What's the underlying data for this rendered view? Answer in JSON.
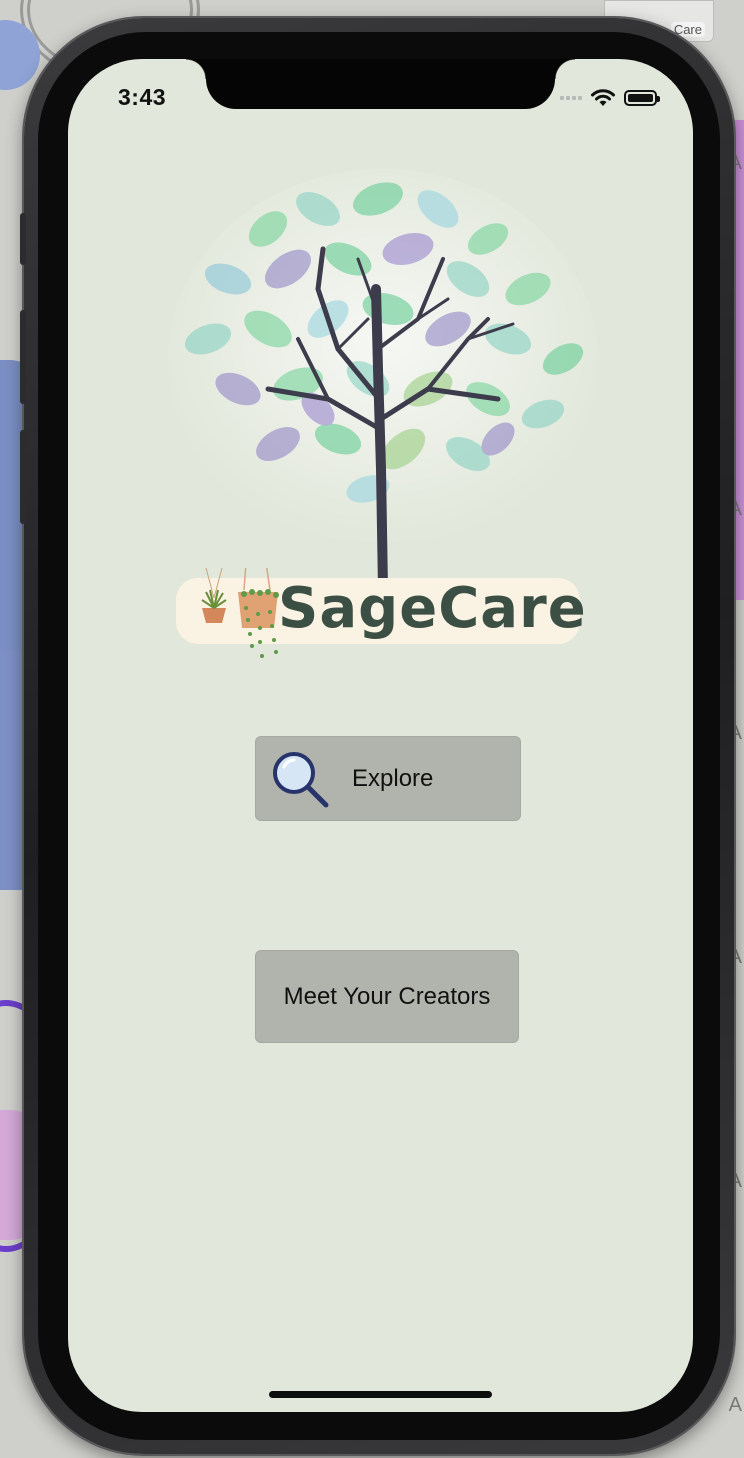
{
  "status_bar": {
    "time": "3:43"
  },
  "app": {
    "logo_text": "SageCare",
    "buttons": {
      "explore": "Explore",
      "creators": "Meet Your Creators"
    }
  },
  "backdrop": {
    "window_label": "Care",
    "edge_letters": [
      "A",
      "A",
      "A",
      "A",
      "A",
      "A"
    ]
  },
  "colors": {
    "screen_background": "#e1e7da",
    "button_background": "#b1b3ad",
    "logo_text": "#3c4f44",
    "logo_banner": "#faf3e3",
    "magnifier": "#26346b",
    "tree_trunk": "#3d3c4c"
  },
  "icons": [
    "tree-logo-icon",
    "hanging-plants-icon",
    "magnifying-glass-icon",
    "wifi-icon",
    "battery-icon",
    "signal-icon"
  ]
}
